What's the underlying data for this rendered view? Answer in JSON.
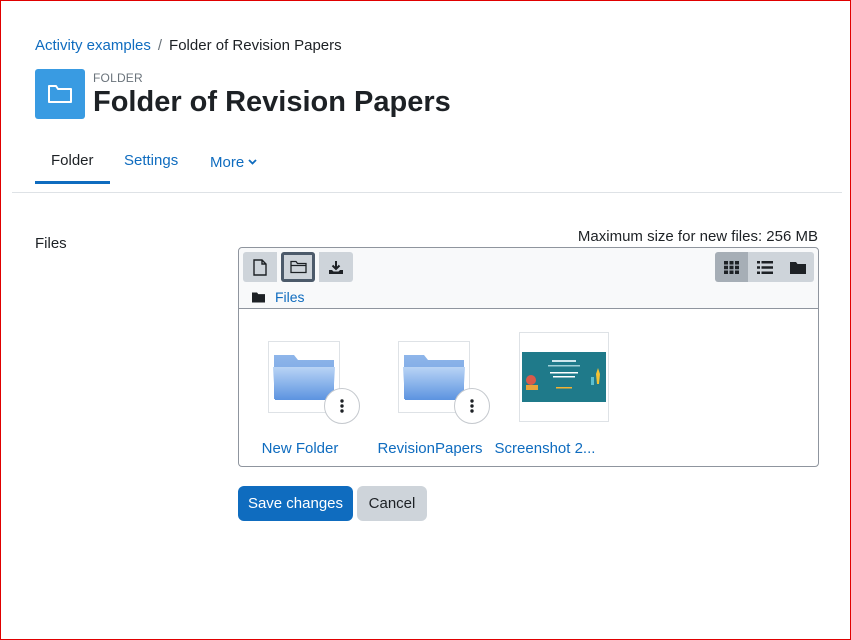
{
  "breadcrumb": {
    "parent": "Activity examples",
    "separator": "/",
    "current": "Folder of Revision Papers"
  },
  "header": {
    "module_type": "FOLDER",
    "title": "Folder of Revision Papers",
    "icon": "folder-icon",
    "icon_bg": "#399be2"
  },
  "tabs": [
    {
      "label": "Folder",
      "active": true
    },
    {
      "label": "Settings",
      "active": false
    },
    {
      "label": "More",
      "active": false,
      "icon": "chevron-down-icon"
    }
  ],
  "form": {
    "files_label": "Files",
    "max_size": "Maximum size for new files: 256 MB"
  },
  "filemanager": {
    "toolbar": {
      "add_file_icon": "file-icon",
      "create_folder_icon": "folder-open-icon",
      "download_icon": "download-icon",
      "views": [
        {
          "icon": "grid-icon",
          "active": true
        },
        {
          "icon": "list-icon",
          "active": false
        },
        {
          "icon": "folder-tree-icon",
          "active": false
        }
      ]
    },
    "path_label": "Files",
    "items": [
      {
        "name": "New Folder",
        "type": "folder"
      },
      {
        "name": "RevisionPapers",
        "type": "folder"
      },
      {
        "name": "Screenshot 2...",
        "type": "image"
      }
    ]
  },
  "actions": {
    "save": "Save changes",
    "cancel": "Cancel"
  },
  "colors": {
    "accent": "#0f6cbf",
    "toolbar_button": "#ced4da",
    "border": "#8f959e"
  }
}
